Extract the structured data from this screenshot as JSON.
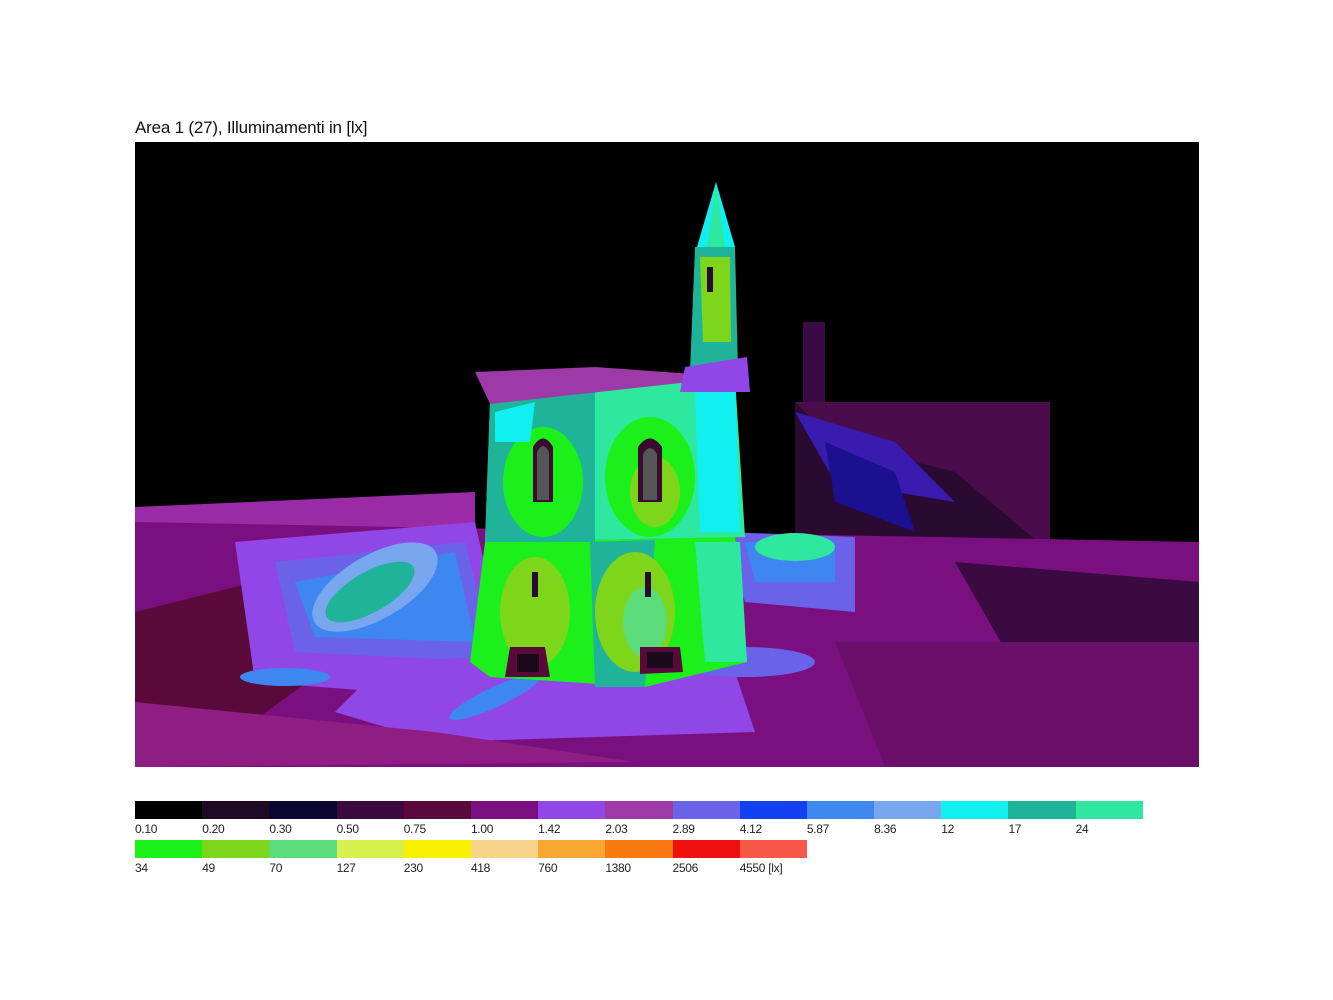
{
  "title": "Area 1 (27), Illuminamenti in [lx]",
  "legend": {
    "row1": [
      {
        "label": "0.10",
        "color": "#000000"
      },
      {
        "label": "0.20",
        "color": "#1f0a24"
      },
      {
        "label": "0.30",
        "color": "#0c0633"
      },
      {
        "label": "0.50",
        "color": "#3a0a40"
      },
      {
        "label": "0.75",
        "color": "#5a0a3a"
      },
      {
        "label": "1.00",
        "color": "#7a1080"
      },
      {
        "label": "1.42",
        "color": "#9146e8"
      },
      {
        "label": "2.03",
        "color": "#9d3aa8"
      },
      {
        "label": "2.89",
        "color": "#6a63ea"
      },
      {
        "label": "4.12",
        "color": "#1340f0"
      },
      {
        "label": "5.87",
        "color": "#3e86f0"
      },
      {
        "label": "8.36",
        "color": "#78a6ef"
      },
      {
        "label": "12",
        "color": "#11f0f0"
      },
      {
        "label": "17",
        "color": "#1fb39a"
      },
      {
        "label": "24",
        "color": "#2ee8a0"
      }
    ],
    "row2": [
      {
        "label": "34",
        "color": "#1bf01b"
      },
      {
        "label": "49",
        "color": "#7ed61a"
      },
      {
        "label": "70",
        "color": "#5bdc7a"
      },
      {
        "label": "127",
        "color": "#d8f04e"
      },
      {
        "label": "230",
        "color": "#f8f000"
      },
      {
        "label": "418",
        "color": "#f8d48a"
      },
      {
        "label": "760",
        "color": "#f8a830"
      },
      {
        "label": "1380",
        "color": "#f87a10"
      },
      {
        "label": "2506",
        "color": "#f01010"
      },
      {
        "label": "4550 [lx]",
        "color": "#f85848"
      }
    ]
  }
}
